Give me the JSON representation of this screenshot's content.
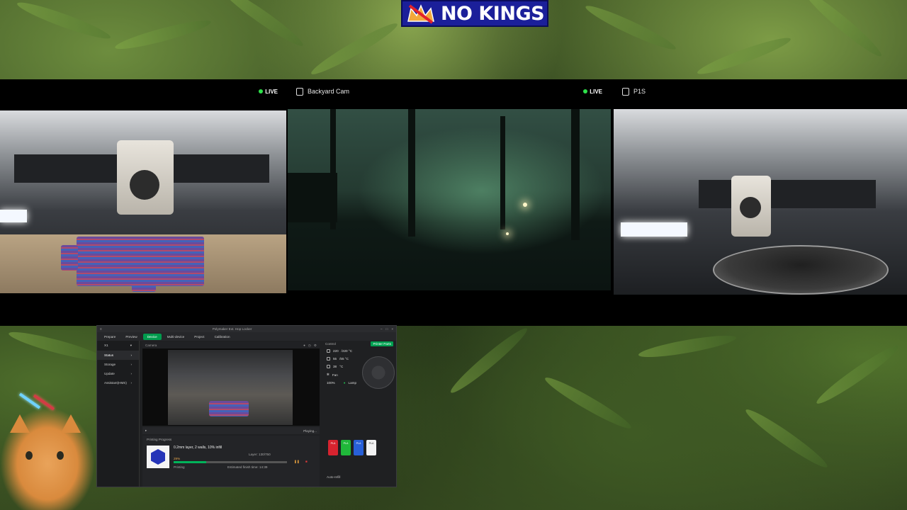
{
  "banner": {
    "text": "NO KINGS"
  },
  "cameras": [
    {
      "title": "",
      "live_label": "LIVE"
    },
    {
      "title": "Backyard Cam",
      "live_label": "LIVE"
    },
    {
      "title": "P1S",
      "live_label": ""
    }
  ],
  "studio": {
    "window_title": "Polymaker Ext. Hop Locker",
    "tabs": [
      {
        "label": "Prepare",
        "icon": "home-icon"
      },
      {
        "label": "Preview",
        "icon": "eye-icon"
      },
      {
        "label": "Device",
        "icon": "printer-icon"
      },
      {
        "label": "Multi-device",
        "icon": "grid-icon"
      },
      {
        "label": "Project",
        "icon": "folder-icon"
      },
      {
        "label": "Calibration",
        "icon": "target-icon"
      }
    ],
    "printer_name": "X1",
    "sidebar": [
      "Status",
      "Storage",
      "Update",
      "Assistant(HMS)"
    ],
    "camera_label": "Camera",
    "playing_label": "Playing...",
    "progress_section": "Printing Progress",
    "job_name": "0.2mm layer, 2 walls, 10% infill",
    "progress_percent": "29%",
    "progress_fraction": 0.29,
    "status": "Printing",
    "layer": "Layer: 130/750",
    "finish_time": "Estimated finish time: 14:39",
    "control_label": "Control",
    "printer_parts_button": "Printer Parts",
    "temps": [
      {
        "value": "220",
        "target": "/220 °C"
      },
      {
        "value": "55",
        "target": "/55 °C"
      },
      {
        "value": "38",
        "target": "°C"
      }
    ],
    "fan_label": "Fan",
    "lamp_label": "Lamp",
    "fan_value": "100%",
    "ams_slots": [
      {
        "label": "PLA",
        "color": "#d7232f"
      },
      {
        "label": "PLA",
        "color": "#20b83a"
      },
      {
        "label": "PLA",
        "color": "#2860d8"
      },
      {
        "label": "PLA",
        "color": "#f2f2f2"
      }
    ],
    "auto_refill": "Auto-refill",
    "accent": "#009b4d"
  }
}
